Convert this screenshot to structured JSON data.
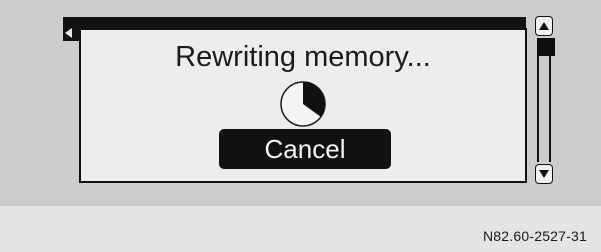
{
  "dialog": {
    "title": "Rewriting memory...",
    "cancel_label": "Cancel",
    "progress": 0.35
  },
  "caption": "N82.60-2527-31",
  "icons": {
    "back": "left-arrow-icon",
    "scroll_up": "chevron-up-icon",
    "scroll_down": "chevron-down-icon",
    "progress": "pie-timer-icon"
  },
  "colors": {
    "screen_bg": "#cdcdcd",
    "dialog_bg": "#ededed",
    "dark": "#111111",
    "button_text": "#f5f5f5"
  }
}
